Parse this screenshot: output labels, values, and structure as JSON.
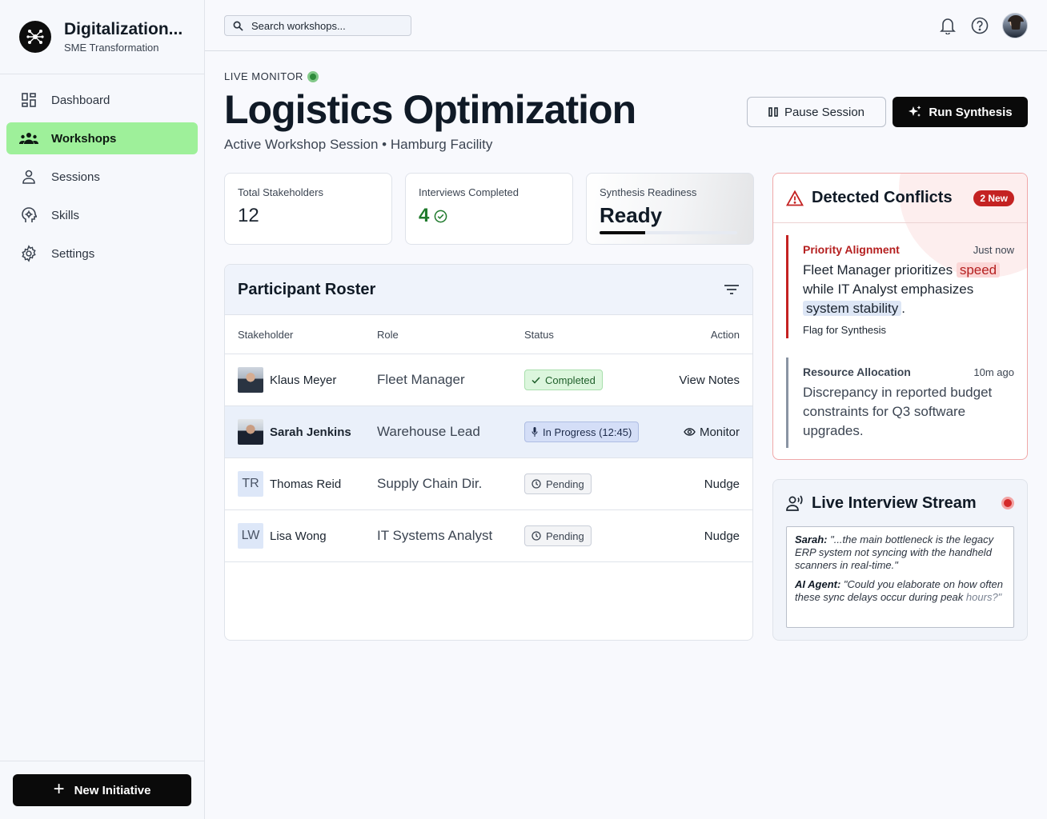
{
  "brand": {
    "title": "Digitalization...",
    "subtitle": "SME Transformation"
  },
  "sidebar": {
    "items": [
      {
        "label": "Dashboard",
        "icon": "dashboard-icon"
      },
      {
        "label": "Workshops",
        "icon": "groups-icon",
        "active": true
      },
      {
        "label": "Sessions",
        "icon": "person-icon"
      },
      {
        "label": "Skills",
        "icon": "brain-icon"
      },
      {
        "label": "Settings",
        "icon": "gear-icon"
      }
    ],
    "new_button": "New Initiative"
  },
  "search": {
    "placeholder": "Search workshops..."
  },
  "header": {
    "live_label": "LIVE MONITOR",
    "title": "Logistics Optimization",
    "subtitle": "Active Workshop Session • Hamburg Facility",
    "pause_label": "Pause Session",
    "run_label": "Run Synthesis"
  },
  "stats": {
    "stakeholders": {
      "label": "Total Stakeholders",
      "value": "12"
    },
    "interviews": {
      "label": "Interviews Completed",
      "value": "4"
    },
    "readiness": {
      "label": "Synthesis Readiness",
      "value": "Ready",
      "progress": 0.33
    }
  },
  "roster": {
    "title": "Participant Roster",
    "columns": {
      "stakeholder": "Stakeholder",
      "role": "Role",
      "status": "Status",
      "action": "Action"
    },
    "rows": [
      {
        "name": "Klaus Meyer",
        "role": "Fleet Manager",
        "status": "Completed",
        "action": "View Notes"
      },
      {
        "name": "Sarah Jenkins",
        "role": "Warehouse Lead",
        "status": "In Progress (12:45)",
        "action": "Monitor"
      },
      {
        "initials": "TR",
        "name": "Thomas Reid",
        "role": "Supply Chain Dir.",
        "status": "Pending",
        "action": "Nudge"
      },
      {
        "initials": "LW",
        "name": "Lisa Wong",
        "role": "IT Systems Analyst",
        "status": "Pending",
        "action": "Nudge"
      }
    ]
  },
  "conflicts": {
    "title": "Detected Conflicts",
    "badge": "2 New",
    "items": [
      {
        "category": "Priority Alignment",
        "time": "Just now",
        "text_a": "Fleet Manager prioritizes",
        "highlight_a": "speed",
        "text_b": "while IT Analyst emphasizes",
        "highlight_b": "system stability",
        "text_c": ".",
        "link": "Flag for Synthesis"
      },
      {
        "category": "Resource Allocation",
        "time": "10m ago",
        "text": "Discrepancy in reported budget constraints for Q3 software upgrades."
      }
    ]
  },
  "stream": {
    "title": "Live Interview Stream",
    "lines": [
      {
        "speaker": "Sarah:",
        "text": "\"...the main bottleneck is the legacy ERP system not syncing with the handheld scanners in real-time.\""
      },
      {
        "speaker": "AI Agent:",
        "text": "\"Could you elaborate on how often these sync delays occur during peak",
        "text_fade": "hours?\""
      }
    ]
  },
  "colors": {
    "active_nav": "#9ef09a",
    "conflict_red": "#c42222",
    "live_green": "#2e8b3b"
  }
}
